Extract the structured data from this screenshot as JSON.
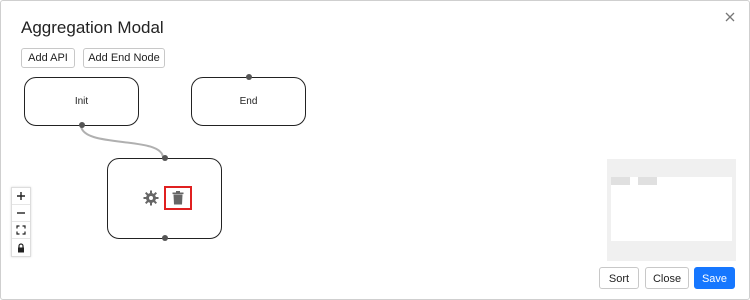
{
  "modal": {
    "title": "Aggregation Modal",
    "close_icon": "close-icon"
  },
  "toolbar": {
    "add_api_label": "Add API",
    "add_end_node_label": "Add End Node"
  },
  "nodes": {
    "init_label": "Init",
    "end_label": "End"
  },
  "api_node": {
    "icons": [
      "gear-icon",
      "trash-icon"
    ],
    "highlight_color": "#e02020"
  },
  "zoom_controls": {
    "icons": [
      "zoom-in-icon",
      "zoom-out-icon",
      "fit-view-icon",
      "lock-icon"
    ]
  },
  "footer": {
    "sort_label": "Sort",
    "close_label": "Close",
    "save_label": "Save"
  },
  "colors": {
    "primary": "#1677ff",
    "edge": "#b0b0b0",
    "handle": "#555555"
  }
}
